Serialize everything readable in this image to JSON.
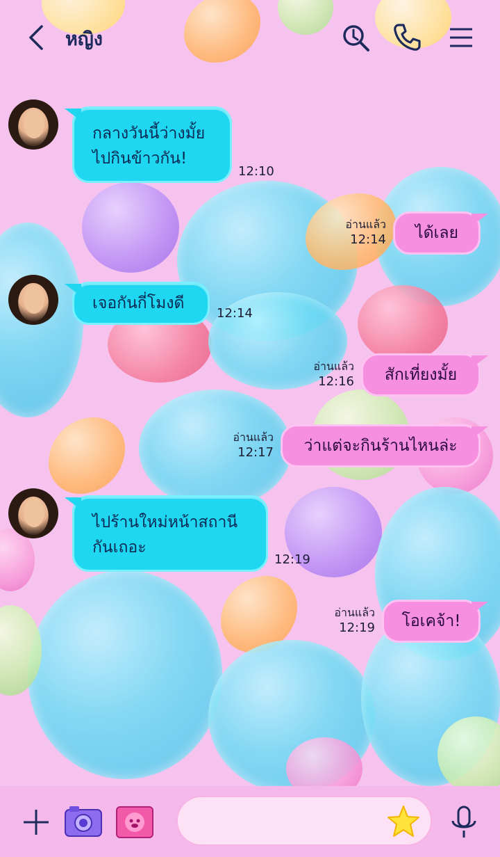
{
  "header": {
    "title": "หญิง"
  },
  "messages": [
    {
      "side": "in",
      "text_line1": "กลางวันนี้ว่างมั้ย",
      "text_line2": "ไปกินข้าวกัน!",
      "time": "12:10"
    },
    {
      "side": "out",
      "text": "ได้เลย",
      "read": "อ่านแล้ว",
      "time": "12:14"
    },
    {
      "side": "in",
      "text": "เจอกันกี่โมงดี",
      "time": "12:14"
    },
    {
      "side": "out",
      "text": "สักเที่ยงมั้ย",
      "read": "อ่านแล้ว",
      "time": "12:16"
    },
    {
      "side": "out",
      "text": "ว่าแต่จะกินร้านไหนล่ะ",
      "read": "อ่านแล้ว",
      "time": "12:17"
    },
    {
      "side": "in",
      "text_line1": "ไปร้านใหม่หน้าสถานี",
      "text_line2": "กันเถอะ",
      "time": "12:19"
    },
    {
      "side": "out",
      "text": "โอเคจ้า!",
      "read": "อ่านแล้ว",
      "time": "12:19"
    }
  ],
  "colors": {
    "background": "#f6c2ee",
    "incoming_bubble": "#1fd7f0",
    "outgoing_bubble": "#f78fe0",
    "icon": "#1d2a5c"
  },
  "icons": {
    "back": "chevron-left-icon",
    "search": "search-icon",
    "call": "phone-icon",
    "menu": "hamburger-menu-icon",
    "add": "plus-icon",
    "camera": "camera-icon",
    "image": "image-icon",
    "sticker": "star-sticker-icon",
    "mic": "microphone-icon"
  }
}
